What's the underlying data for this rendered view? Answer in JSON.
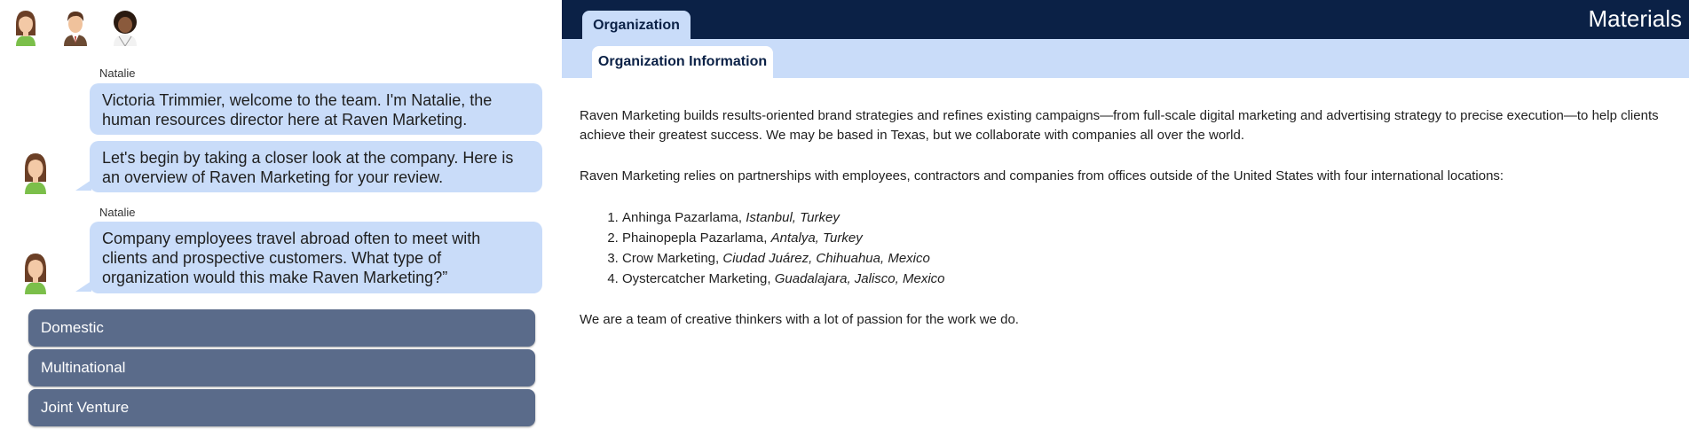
{
  "chat": {
    "sender1": "Natalie",
    "bubble1": "Victoria Trimmier, welcome to the team. I'm Natalie, the human resources director here at Raven Marketing.",
    "bubble2": "Let's begin by taking a closer look at the company.  Here is an overview of Raven Marketing for your review.",
    "sender2": "Natalie",
    "bubble3": "Company employees travel abroad often to meet with clients and prospective customers. What type of organization would this make Raven Marketing?”",
    "choices": [
      "Domestic",
      "Multinational",
      "Joint Venture"
    ]
  },
  "materials": {
    "title": "Materials",
    "tab": "Organization",
    "subtab": "Organization Information",
    "para1": "Raven Marketing builds results-oriented brand strategies and refines existing campaigns—from full-scale digital marketing and advertising strategy to precise execution—to help clients achieve their greatest success. We may be based in Texas, but we collaborate with companies all over the world.",
    "para2": "Raven Marketing relies on partnerships with employees, contractors and companies from offices outside of the United States with four international locations:",
    "locations": [
      {
        "name": "Anhinga Pazarlama,",
        "place": "Istanbul, Turkey"
      },
      {
        "name": "Phainopepla Pazarlama,",
        "place": "Antalya, Turkey"
      },
      {
        "name": "Crow Marketing,",
        "place": "Ciudad Juárez, Chihuahua, Mexico"
      },
      {
        "name": "Oystercatcher Marketing,",
        "place": "Guadalajara, Jalisco, Mexico"
      }
    ],
    "para3": "We are a team of creative thinkers with a lot of passion for the work we do."
  },
  "colors": {
    "navy": "#0b2146",
    "bubble": "#c9dcf9",
    "choice": "#5a6b8a"
  }
}
